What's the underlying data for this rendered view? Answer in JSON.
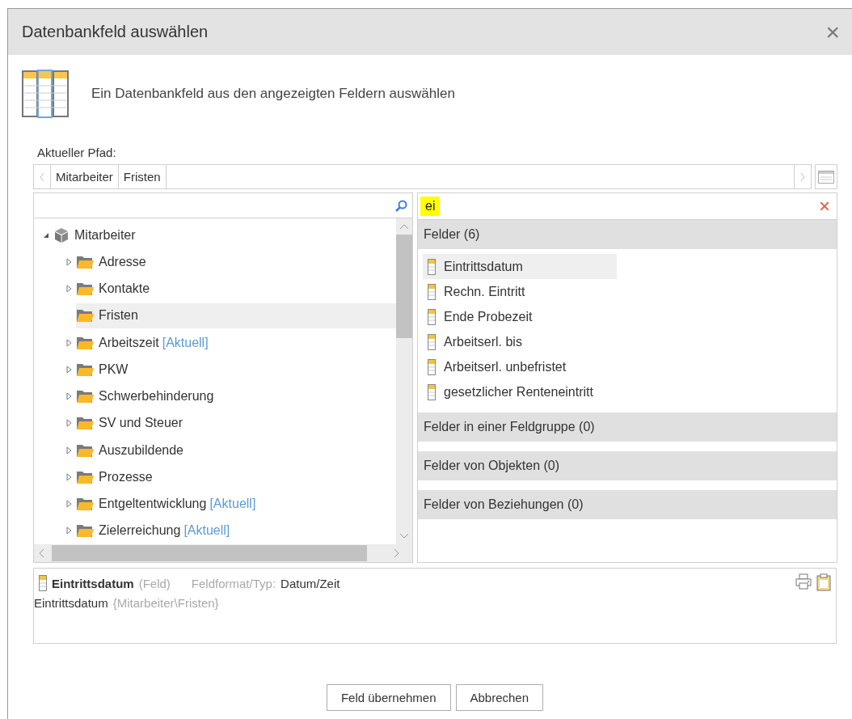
{
  "window": {
    "title": "Datenbankfeld auswählen",
    "close": "×"
  },
  "intro": "Ein Datenbankfeld aus den angezeigten Feldern auswählen",
  "path": {
    "label": "Aktueller Pfad:",
    "segments": [
      "Mitarbeiter",
      "Fristen"
    ]
  },
  "tree": [
    {
      "label": "Mitarbeiter",
      "kind": "object",
      "expanded": true,
      "selected": false,
      "children": [
        {
          "label": "Adresse",
          "kind": "folder",
          "expanded": false,
          "selected": false
        },
        {
          "label": "Kontakte",
          "kind": "folder",
          "expanded": false,
          "selected": false
        },
        {
          "label": "Fristen",
          "kind": "folder",
          "selected": true
        },
        {
          "label": "Arbeitszeit",
          "tag": "[Aktuell]",
          "kind": "folder",
          "expanded": false,
          "selected": false
        },
        {
          "label": "PKW",
          "kind": "folder",
          "expanded": false,
          "selected": false
        },
        {
          "label": "Schwerbehinderung",
          "kind": "folder",
          "expanded": false,
          "selected": false
        },
        {
          "label": "SV und Steuer",
          "kind": "folder",
          "expanded": false,
          "selected": false
        },
        {
          "label": "Auszubildende",
          "kind": "folder",
          "expanded": false,
          "selected": false
        },
        {
          "label": "Prozesse",
          "kind": "folder",
          "expanded": false,
          "selected": false
        },
        {
          "label": "Entgeltentwicklung",
          "tag": "[Aktuell]",
          "kind": "folder",
          "expanded": false,
          "selected": false
        },
        {
          "label": "Zielerreichung",
          "tag": "[Aktuell]",
          "kind": "folder",
          "expanded": false,
          "selected": false
        }
      ]
    }
  ],
  "field_search": {
    "value": "ei",
    "clear": "×"
  },
  "sections": [
    {
      "title": "Felder (6)",
      "items": [
        {
          "label": "Eintrittsdatum",
          "selected": true
        },
        {
          "label": "Rechn. Eintritt",
          "selected": false
        },
        {
          "label": "Ende Probezeit",
          "selected": false
        },
        {
          "label": "Arbeitserl. bis",
          "selected": false
        },
        {
          "label": "Arbeitserl. unbefristet",
          "selected": false
        },
        {
          "label": "gesetzlicher Renteneintritt",
          "selected": false
        }
      ]
    },
    {
      "title": "Felder in einer Feldgruppe (0)"
    },
    {
      "title": "Felder von Objekten (0)"
    },
    {
      "title": "Felder von Beziehungen (0)"
    }
  ],
  "details": {
    "name": "Eintrittsdatum",
    "kind": "(Feld)",
    "format_label": "Feldformat/Typ:",
    "format": "Datum/Zeit",
    "path_name": "Eintrittsdatum",
    "path": "{Mitarbeiter\\Fristen}"
  },
  "buttons": [
    "Feld übernehmen",
    "Abbrechen"
  ]
}
